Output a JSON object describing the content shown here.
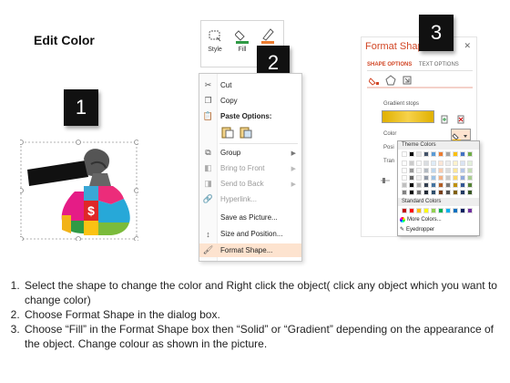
{
  "page": {
    "title": "Edit Color"
  },
  "callouts": [
    "1",
    "2",
    "3"
  ],
  "ribbon": {
    "style_label": "Style",
    "fill_label": "Fill",
    "outline_label": "O"
  },
  "context_menu": {
    "items": [
      {
        "label": "Cut",
        "icon": "scissors-icon",
        "disabled": false
      },
      {
        "label": "Copy",
        "icon": "copy-icon",
        "disabled": false
      },
      {
        "label": "Paste Options:",
        "icon": "paste-icon",
        "disabled": false,
        "bold": true
      },
      {
        "label": "Group",
        "icon": "group-icon",
        "disabled": false,
        "submenu": true
      },
      {
        "label": "Bring to Front",
        "icon": "bring-to-front-icon",
        "disabled": true,
        "submenu": true
      },
      {
        "label": "Send to Back",
        "icon": "send-to-back-icon",
        "disabled": true,
        "submenu": true
      },
      {
        "label": "Hyperlink...",
        "icon": "hyperlink-icon",
        "disabled": true
      },
      {
        "label": "Save as Picture...",
        "icon": "",
        "disabled": false
      },
      {
        "label": "Size and Position...",
        "icon": "size-position-icon",
        "disabled": false
      },
      {
        "label": "Format Shape...",
        "icon": "format-shape-icon",
        "disabled": false,
        "highlighted": true
      }
    ]
  },
  "format_pane": {
    "title": "Format Shap",
    "close_label": "✕",
    "tabs": [
      "SHAPE OPTIONS",
      "TEXT OPTIONS"
    ],
    "gradient_stops_label": "Gradient stops",
    "color_label": "Color",
    "posi_label": "Posi",
    "tran_label": "Tran",
    "palette": {
      "theme_colors_label": "Theme Colors",
      "standard_colors_label": "Standard Colors",
      "more_colors_label": "More Colors...",
      "eyedropper_label": "Eyedropper",
      "theme_top_row": [
        "#ffffff",
        "#000000",
        "#e7e6e6",
        "#44546a",
        "#5b9bd5",
        "#ed7d31",
        "#a5a5a5",
        "#ffc000",
        "#4472c4",
        "#70ad47"
      ],
      "standard_row": [
        "#c00000",
        "#ff0000",
        "#ffc000",
        "#ffff00",
        "#92d050",
        "#00b050",
        "#00b0f0",
        "#0070c0",
        "#002060",
        "#7030a0"
      ]
    }
  },
  "instructions": [
    "Select the shape to change the color and Right click the object( click any object which you want to change color)",
    "Choose Format Shape in the dialog box.",
    "Choose “Fill” in the Format Shape box then “Solid” or “Gradient” depending on the appearance of the object. Change colour as shown in the picture."
  ]
}
